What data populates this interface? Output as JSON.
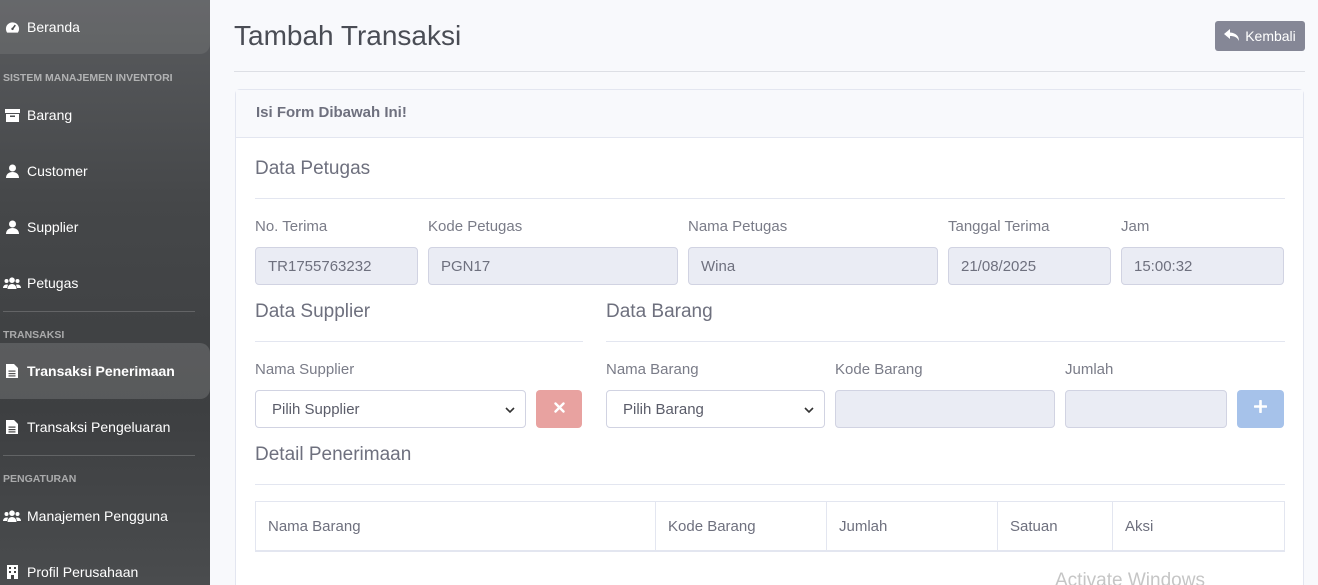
{
  "sidebar": {
    "items": [
      {
        "label": "Beranda",
        "icon": "tachometer-icon"
      },
      {
        "label": "Barang",
        "icon": "box-icon"
      },
      {
        "label": "Customer",
        "icon": "user-icon"
      },
      {
        "label": "Supplier",
        "icon": "user-icon"
      },
      {
        "label": "Petugas",
        "icon": "users-icon"
      },
      {
        "label": "Transaksi Penerimaan",
        "icon": "file-icon"
      },
      {
        "label": "Transaksi Pengeluaran",
        "icon": "file-icon"
      },
      {
        "label": "Manajemen Pengguna",
        "icon": "users-icon"
      },
      {
        "label": "Profil Perusahaan",
        "icon": "building-icon"
      }
    ],
    "headings": [
      "SISTEM MANAJEMEN INVENTORI",
      "TRANSAKSI",
      "PENGATURAN"
    ]
  },
  "header": {
    "title": "Tambah Transaksi",
    "back_label": "Kembali"
  },
  "card": {
    "header": "Isi Form Dibawah Ini!"
  },
  "petugas": {
    "title": "Data Petugas",
    "fields": [
      {
        "label": "No. Terima",
        "value": "TR1755763232"
      },
      {
        "label": "Kode Petugas",
        "value": "PGN17"
      },
      {
        "label": "Nama Petugas",
        "value": "Wina"
      },
      {
        "label": "Tanggal Terima",
        "value": "21/08/2025"
      },
      {
        "label": "Jam",
        "value": "15:00:32"
      }
    ]
  },
  "supplier": {
    "title": "Data Supplier",
    "label": "Nama Supplier",
    "selected": "Pilih Supplier"
  },
  "barang": {
    "title": "Data Barang",
    "nama_label": "Nama Barang",
    "nama_selected": "Pilih Barang",
    "kode_label": "Kode Barang",
    "kode_value": "",
    "jumlah_label": "Jumlah",
    "jumlah_value": ""
  },
  "detail": {
    "title": "Detail Penerimaan",
    "columns": [
      "Nama Barang",
      "Kode Barang",
      "Jumlah",
      "Satuan",
      "Aksi"
    ]
  },
  "watermark": "Activate Windows",
  "colors": {
    "danger_light": "#e8a2a0",
    "primary_light": "#a6c2ea",
    "secondary": "#858796"
  }
}
